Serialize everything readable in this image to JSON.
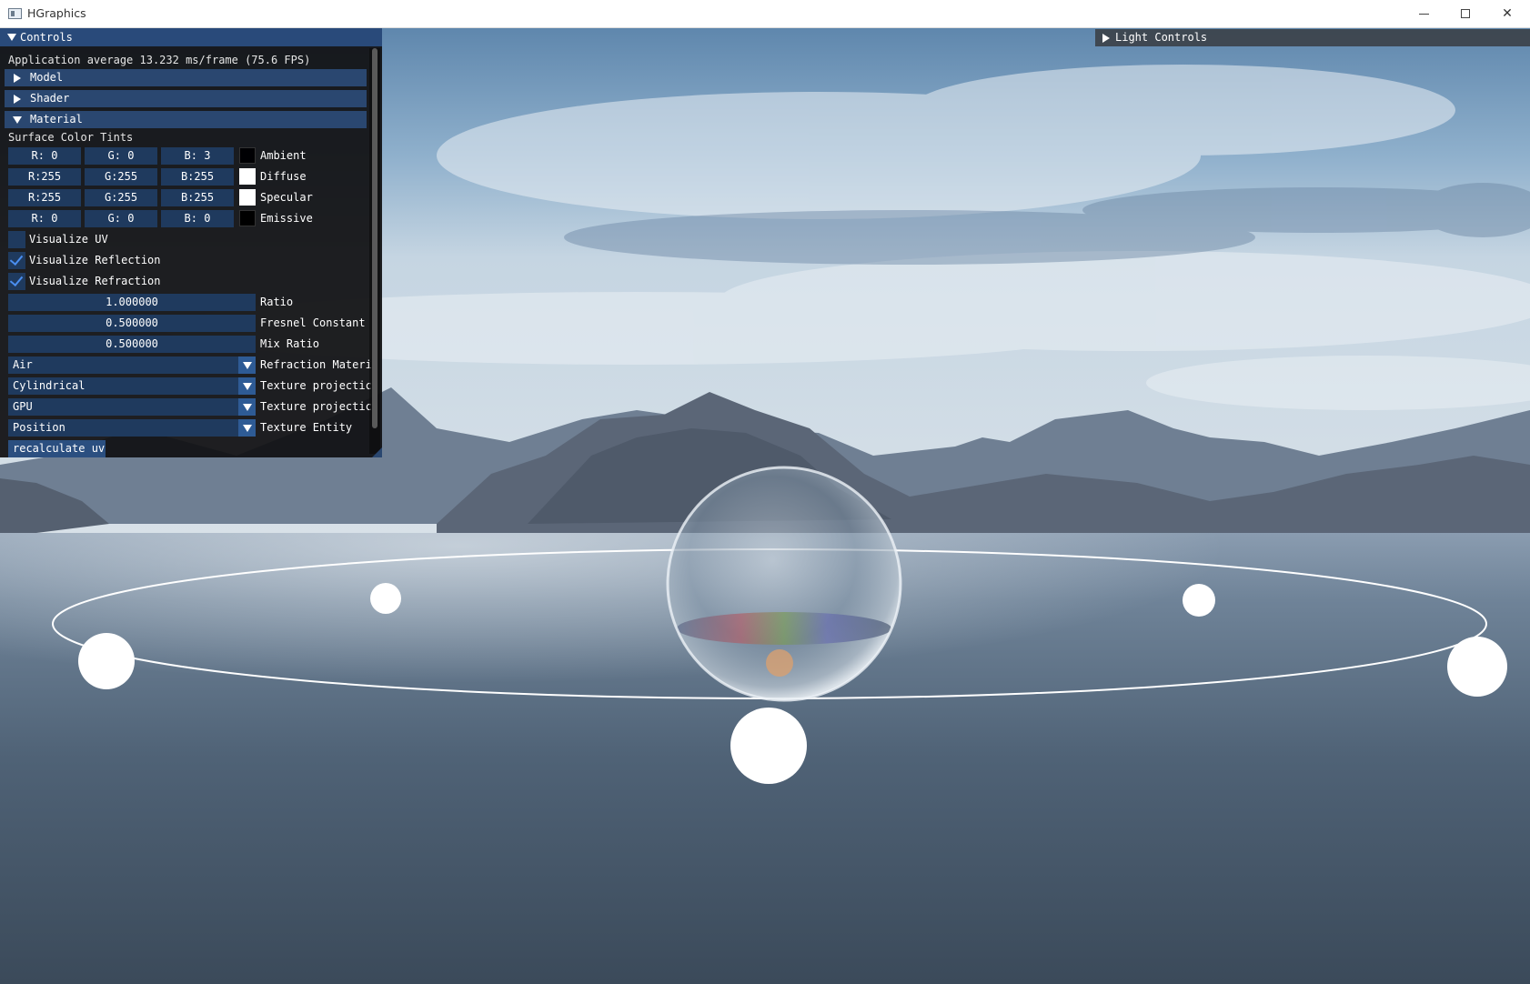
{
  "window": {
    "title": "HGraphics"
  },
  "controls": {
    "title": "Controls",
    "fps_text": "Application average 13.232 ms/frame (75.6 FPS)",
    "headers": {
      "model": "Model",
      "shader": "Shader",
      "material": "Material"
    },
    "surface_color_tints_label": "Surface Color Tints",
    "tints": [
      {
        "r": "R:  0",
        "g": "G:  0",
        "b": "B:  3",
        "label": "Ambient",
        "swatch": "#000003"
      },
      {
        "r": "R:255",
        "g": "G:255",
        "b": "B:255",
        "label": "Diffuse",
        "swatch": "#ffffff"
      },
      {
        "r": "R:255",
        "g": "G:255",
        "b": "B:255",
        "label": "Specular",
        "swatch": "#ffffff"
      },
      {
        "r": "R:  0",
        "g": "G:  0",
        "b": "B:  0",
        "label": "Emissive",
        "swatch": "#000000"
      }
    ],
    "checkboxes": [
      {
        "label": "Visualize UV",
        "checked": false
      },
      {
        "label": "Visualize Reflection",
        "checked": true
      },
      {
        "label": "Visualize Refraction",
        "checked": true
      }
    ],
    "sliders": [
      {
        "value": "1.000000",
        "label": "Ratio"
      },
      {
        "value": "0.500000",
        "label": "Fresnel Constant"
      },
      {
        "value": "0.500000",
        "label": "Mix Ratio"
      }
    ],
    "combos": [
      {
        "value": "Air",
        "label": "Refraction Materi"
      },
      {
        "value": "Cylindrical",
        "label": "Texture projectic"
      },
      {
        "value": "GPU",
        "label": "Texture projectic"
      },
      {
        "value": "Position",
        "label": "Texture Entity"
      }
    ],
    "recalc_button": "recalculate uv"
  },
  "light_controls": {
    "title": "Light Controls"
  },
  "colors": {
    "title_active": "#294a7a",
    "header": "#2a4770",
    "frame": "#1f3a5e",
    "check": "#4a8ef0"
  }
}
